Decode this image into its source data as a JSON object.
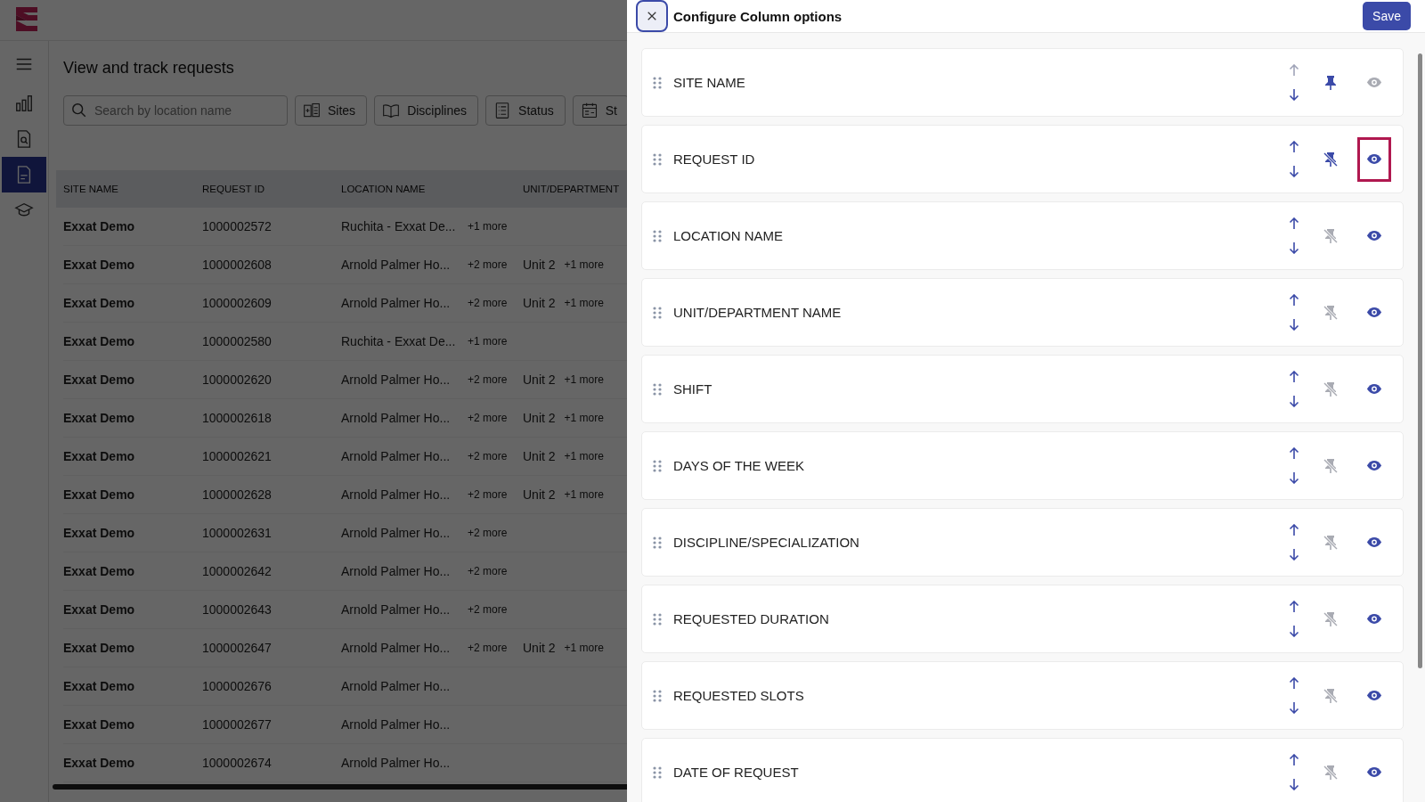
{
  "page": {
    "title": "View and track requests",
    "search": {
      "placeholder": "Search by location name"
    },
    "filters": [
      {
        "label": "Sites",
        "kind": "sites"
      },
      {
        "label": "Disciplines",
        "kind": "book"
      },
      {
        "label": "Status",
        "kind": "list"
      },
      {
        "label": "St",
        "kind": "calendar"
      }
    ],
    "nav": [
      {
        "kind": "menu",
        "selected": false
      },
      {
        "kind": "chart",
        "selected": false
      },
      {
        "kind": "search-doc",
        "selected": false
      },
      {
        "kind": "doc",
        "selected": true
      },
      {
        "kind": "cap",
        "selected": false
      }
    ],
    "table": {
      "columns": [
        "SITE NAME",
        "REQUEST ID",
        "LOCATION NAME",
        "UNIT/DEPARTMENT"
      ],
      "rows": [
        {
          "site": "Exxat Demo",
          "id": "1000002572",
          "location": "Ruchita - Exxat De...",
          "location_more": "+1 more"
        },
        {
          "site": "Exxat Demo",
          "id": "1000002608",
          "location": "Arnold Palmer Ho...",
          "location_more": "+2 more",
          "unit": "Unit 2",
          "unit_more": "+1 more"
        },
        {
          "site": "Exxat Demo",
          "id": "1000002609",
          "location": "Arnold Palmer Ho...",
          "location_more": "+2 more",
          "unit": "Unit 2",
          "unit_more": "+1 more"
        },
        {
          "site": "Exxat Demo",
          "id": "1000002580",
          "location": "Ruchita - Exxat De...",
          "location_more": "+1 more"
        },
        {
          "site": "Exxat Demo",
          "id": "1000002620",
          "location": "Arnold Palmer Ho...",
          "location_more": "+2 more",
          "unit": "Unit 2",
          "unit_more": "+1 more"
        },
        {
          "site": "Exxat Demo",
          "id": "1000002618",
          "location": "Arnold Palmer Ho...",
          "location_more": "+2 more",
          "unit": "Unit 2",
          "unit_more": "+1 more"
        },
        {
          "site": "Exxat Demo",
          "id": "1000002621",
          "location": "Arnold Palmer Ho...",
          "location_more": "+2 more",
          "unit": "Unit 2",
          "unit_more": "+1 more"
        },
        {
          "site": "Exxat Demo",
          "id": "1000002628",
          "location": "Arnold Palmer Ho...",
          "location_more": "+2 more",
          "unit": "Unit 2",
          "unit_more": "+1 more"
        },
        {
          "site": "Exxat Demo",
          "id": "1000002631",
          "location": "Arnold Palmer Ho...",
          "location_more": "+2 more"
        },
        {
          "site": "Exxat Demo",
          "id": "1000002642",
          "location": "Arnold Palmer Ho...",
          "location_more": "+2 more"
        },
        {
          "site": "Exxat Demo",
          "id": "1000002643",
          "location": "Arnold Palmer Ho...",
          "location_more": "+2 more"
        },
        {
          "site": "Exxat Demo",
          "id": "1000002647",
          "location": "Arnold Palmer Ho...",
          "location_more": "+2 more",
          "unit": "Unit 2",
          "unit_more": "+1 more"
        },
        {
          "site": "Exxat Demo",
          "id": "1000002676",
          "location": "Arnold Palmer Ho..."
        },
        {
          "site": "Exxat Demo",
          "id": "1000002677",
          "location": "Arnold Palmer Ho..."
        },
        {
          "site": "Exxat Demo",
          "id": "1000002674",
          "location": "Arnold Palmer Ho..."
        }
      ]
    }
  },
  "panel": {
    "title": "Configure Column options",
    "save": "Save",
    "columns": [
      {
        "name": "SITE NAME",
        "can_move_up": false,
        "pinned": true,
        "pin_enabled": true,
        "visible_enabled": false,
        "highlighted": false
      },
      {
        "name": "REQUEST ID",
        "can_move_up": true,
        "pinned": false,
        "pin_enabled": true,
        "visible_enabled": true,
        "highlighted": true
      },
      {
        "name": "LOCATION NAME",
        "can_move_up": true,
        "pinned": false,
        "pin_enabled": false,
        "visible_enabled": true,
        "highlighted": false
      },
      {
        "name": "UNIT/DEPARTMENT NAME",
        "can_move_up": true,
        "pinned": false,
        "pin_enabled": false,
        "visible_enabled": true,
        "highlighted": false
      },
      {
        "name": "SHIFT",
        "can_move_up": true,
        "pinned": false,
        "pin_enabled": false,
        "visible_enabled": true,
        "highlighted": false
      },
      {
        "name": "DAYS OF THE WEEK",
        "can_move_up": true,
        "pinned": false,
        "pin_enabled": false,
        "visible_enabled": true,
        "highlighted": false
      },
      {
        "name": "DISCIPLINE/SPECIALIZATION",
        "can_move_up": true,
        "pinned": false,
        "pin_enabled": false,
        "visible_enabled": true,
        "highlighted": false
      },
      {
        "name": "REQUESTED DURATION",
        "can_move_up": true,
        "pinned": false,
        "pin_enabled": false,
        "visible_enabled": true,
        "highlighted": false
      },
      {
        "name": "REQUESTED SLOTS",
        "can_move_up": true,
        "pinned": false,
        "pin_enabled": false,
        "visible_enabled": true,
        "highlighted": false
      },
      {
        "name": "DATE OF REQUEST",
        "can_move_up": true,
        "pinned": false,
        "pin_enabled": false,
        "visible_enabled": true,
        "highlighted": false
      }
    ]
  }
}
